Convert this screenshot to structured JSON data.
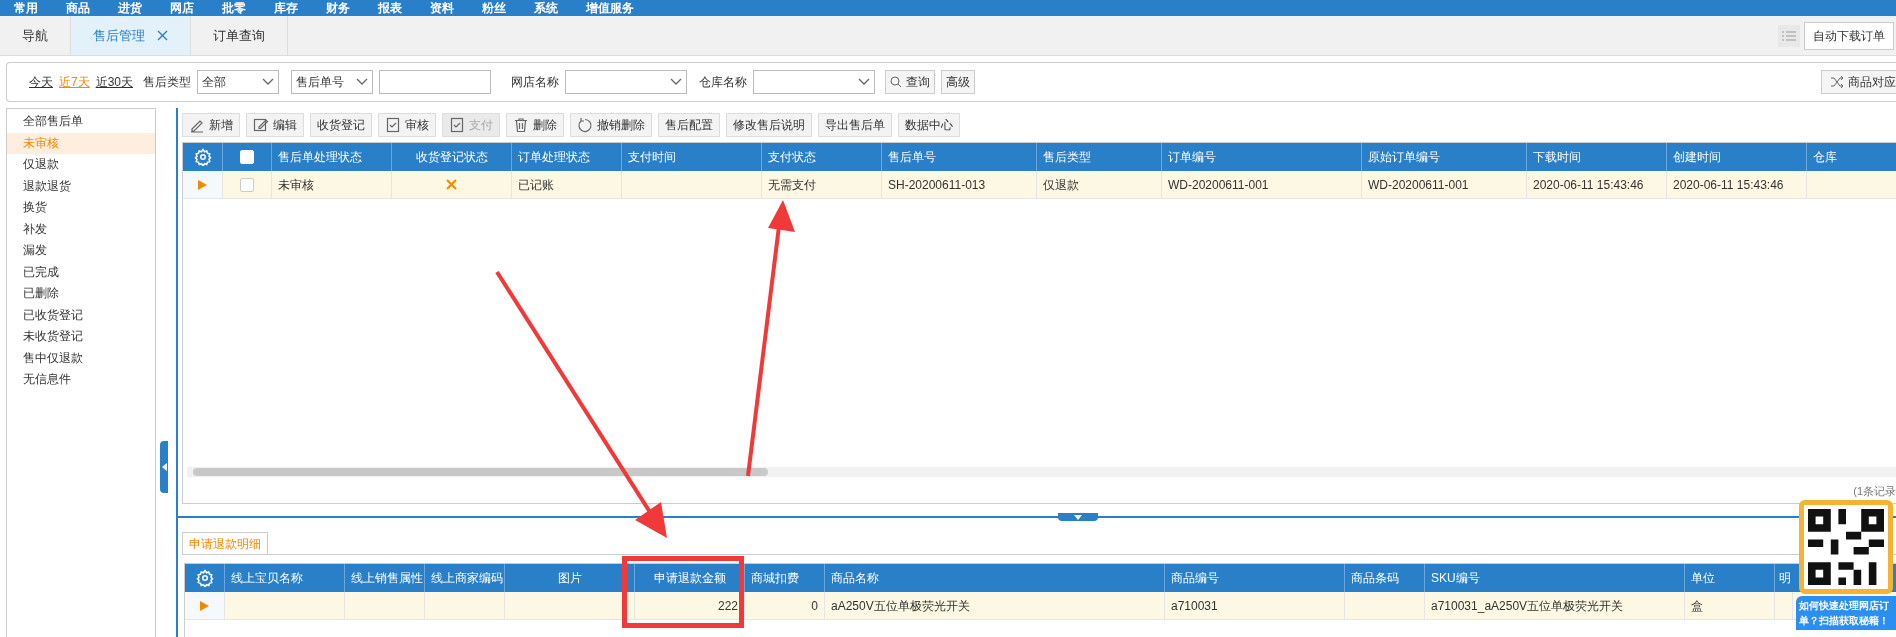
{
  "menu": [
    {
      "label": "常用"
    },
    {
      "label": "商品"
    },
    {
      "label": "进货"
    },
    {
      "label": "网店"
    },
    {
      "label": "批零"
    },
    {
      "label": "库存"
    },
    {
      "label": "财务"
    },
    {
      "label": "报表"
    },
    {
      "label": "资料"
    },
    {
      "label": "粉丝"
    },
    {
      "label": "系统"
    },
    {
      "label": "增值服务"
    }
  ],
  "tabs": [
    {
      "label": "导航",
      "selected": false,
      "closable": false
    },
    {
      "label": "售后管理",
      "selected": true,
      "closable": true
    },
    {
      "label": "订单查询",
      "selected": false,
      "closable": false
    }
  ],
  "auto_download": "自动下载订单",
  "filter": {
    "dates": [
      {
        "label": "今天",
        "selected": false
      },
      {
        "label": "近7天",
        "selected": true
      },
      {
        "label": "近30天",
        "selected": false
      }
    ],
    "type_label": "售后类型",
    "type_value": "全部",
    "field_value": "售后单号",
    "shop_label": "网店名称",
    "warehouse_label": "仓库名称",
    "query": "查询",
    "advanced": "高级",
    "product_map": "商品对应"
  },
  "sidebar": [
    {
      "label": "全部售后单",
      "selected": false
    },
    {
      "label": "未审核",
      "selected": true
    },
    {
      "label": "仅退款",
      "selected": false
    },
    {
      "label": "退款退货",
      "selected": false
    },
    {
      "label": "换货",
      "selected": false
    },
    {
      "label": "补发",
      "selected": false
    },
    {
      "label": "漏发",
      "selected": false
    },
    {
      "label": "已完成",
      "selected": false
    },
    {
      "label": "已删除",
      "selected": false
    },
    {
      "label": "已收货登记",
      "selected": false
    },
    {
      "label": "未收货登记",
      "selected": false
    },
    {
      "label": "售中仅退款",
      "selected": false
    },
    {
      "label": "无信息件",
      "selected": false
    }
  ],
  "toolbar": [
    {
      "label": "新增",
      "kind": "pen",
      "disabled": false
    },
    {
      "label": "编辑",
      "kind": "edit",
      "disabled": false
    },
    {
      "label": "收货登记",
      "kind": "plain",
      "disabled": false
    },
    {
      "label": "审核",
      "kind": "check",
      "disabled": false
    },
    {
      "label": "支付",
      "kind": "check",
      "disabled": true
    },
    {
      "label": "删除",
      "kind": "trash",
      "disabled": false
    },
    {
      "label": "撤销删除",
      "kind": "undo",
      "disabled": false
    },
    {
      "label": "售后配置",
      "kind": "plain",
      "disabled": false
    },
    {
      "label": "修改售后说明",
      "kind": "plain",
      "disabled": false
    },
    {
      "label": "导出售后单",
      "kind": "plain",
      "disabled": false
    },
    {
      "label": "数据中心",
      "kind": "plain",
      "disabled": false
    }
  ],
  "table": {
    "all_checked": false,
    "columns": [
      "售后单处理状态",
      "收货登记状态",
      "订单处理状态",
      "支付时间",
      "支付状态",
      "售后单号",
      "售后类型",
      "订单编号",
      "原始订单编号",
      "下载时间",
      "创建时间",
      "仓库"
    ],
    "rows": [
      {
        "selected": true,
        "checked": false,
        "cells": [
          {
            "kind": "text",
            "text": "未审核"
          },
          {
            "kind": "status",
            "done": false
          },
          {
            "kind": "text",
            "text": "已记账"
          },
          {
            "kind": "text",
            "text": ""
          },
          {
            "kind": "text",
            "text": "无需支付"
          },
          {
            "kind": "text",
            "text": "SH-20200611-013"
          },
          {
            "kind": "text",
            "text": "仅退款"
          },
          {
            "kind": "text",
            "text": "WD-20200611-001"
          },
          {
            "kind": "text",
            "text": "WD-20200611-001"
          },
          {
            "kind": "text",
            "text": "2020-06-11 15:43:46"
          },
          {
            "kind": "text",
            "text": "2020-06-11 15:43:46"
          },
          {
            "kind": "text",
            "text": ""
          }
        ]
      }
    ],
    "record_count": "(1条记录"
  },
  "detail": {
    "tab": "申请退款明细",
    "columns": [
      "线上宝贝名称",
      "线上销售属性",
      "线上商家编码",
      "图片",
      "申请退款金额",
      "商城扣费",
      "商品名称",
      "商品编号",
      "商品条码",
      "SKU编号",
      "单位",
      "明"
    ],
    "rows": [
      {
        "selected": true,
        "cells": [
          "",
          "",
          "",
          "",
          "222",
          "0",
          "aA250V五位单极荧光开关",
          "a710031",
          "",
          "a710031_aA250V五位单极荧光开关",
          "盒",
          ""
        ]
      }
    ]
  },
  "promo": {
    "lines": [
      "如何快速处理网店订",
      "单？扫描获取秘籍！"
    ]
  }
}
